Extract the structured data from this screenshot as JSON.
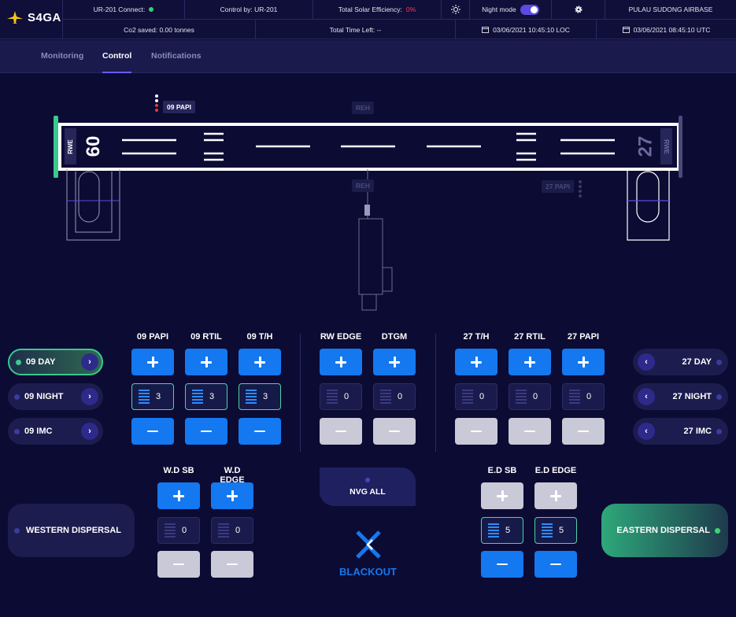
{
  "header": {
    "logo_text": "S4GA",
    "connect_label": "UR-201 Connect:",
    "control_label": "Control by: UR-201",
    "efficiency_label": "Total Solar Efficiency:",
    "efficiency_value": "0%",
    "night_mode_label": "Night mode",
    "night_mode_on": true,
    "airbase": "PULAU SUDONG AIRBASE",
    "co2": "Co2 saved: 0.00 tonnes",
    "time_left": "Total Time Left: --",
    "loc_time": "03/06/2021 10:45:10 LOC",
    "utc_time": "03/06/2021 08:45:10 UTC",
    "colors": {
      "connect_dot": "#2fd16f",
      "efficiency": "#ff3b4c",
      "accent": "#6a5cf0"
    }
  },
  "tabs": [
    {
      "label": "Monitoring",
      "active": false
    },
    {
      "label": "Control",
      "active": true
    },
    {
      "label": "Notifications",
      "active": false
    }
  ],
  "diagram": {
    "papi_09": "09 PAPI",
    "papi_27": "27 PAPI",
    "reh_top": "REH",
    "reh_bottom": "REH",
    "rwe_left": "RWE",
    "rwe_right": "RWE",
    "runway_09": "09",
    "runway_27": "27"
  },
  "presets_left": [
    {
      "label": "09 DAY",
      "active": true
    },
    {
      "label": "09 NIGHT",
      "active": false
    },
    {
      "label": "09 IMC",
      "active": false
    }
  ],
  "presets_right": [
    {
      "label": "27 DAY"
    },
    {
      "label": "27 NIGHT"
    },
    {
      "label": "27 IMC"
    }
  ],
  "groups": {
    "west": [
      {
        "title": "09 PAPI",
        "value": "3",
        "on": true
      },
      {
        "title": "09 RTIL",
        "value": "3",
        "on": true
      },
      {
        "title": "09 T/H",
        "value": "3",
        "on": true
      }
    ],
    "center": [
      {
        "title": "RW EDGE",
        "value": "0",
        "on": false
      },
      {
        "title": "DTGM",
        "value": "0",
        "on": false
      }
    ],
    "east": [
      {
        "title": "27 T/H",
        "value": "0",
        "on": false
      },
      {
        "title": "27 RTIL",
        "value": "0",
        "on": false
      },
      {
        "title": "27 PAPI",
        "value": "0",
        "on": false
      }
    ],
    "wd": [
      {
        "title": "W.D SB",
        "value": "0",
        "on": false
      },
      {
        "title": "W.D EDGE",
        "value": "0",
        "on": false
      }
    ],
    "ed": [
      {
        "title": "E.D SB",
        "value": "5",
        "on": true
      },
      {
        "title": "E.D EDGE",
        "value": "5",
        "on": true
      }
    ]
  },
  "western_dispersal": "WESTERN DISPERSAL",
  "eastern_dispersal": "EASTERN DISPERSAL",
  "nvg_all": "NVG ALL",
  "blackout": "BLACKOUT"
}
